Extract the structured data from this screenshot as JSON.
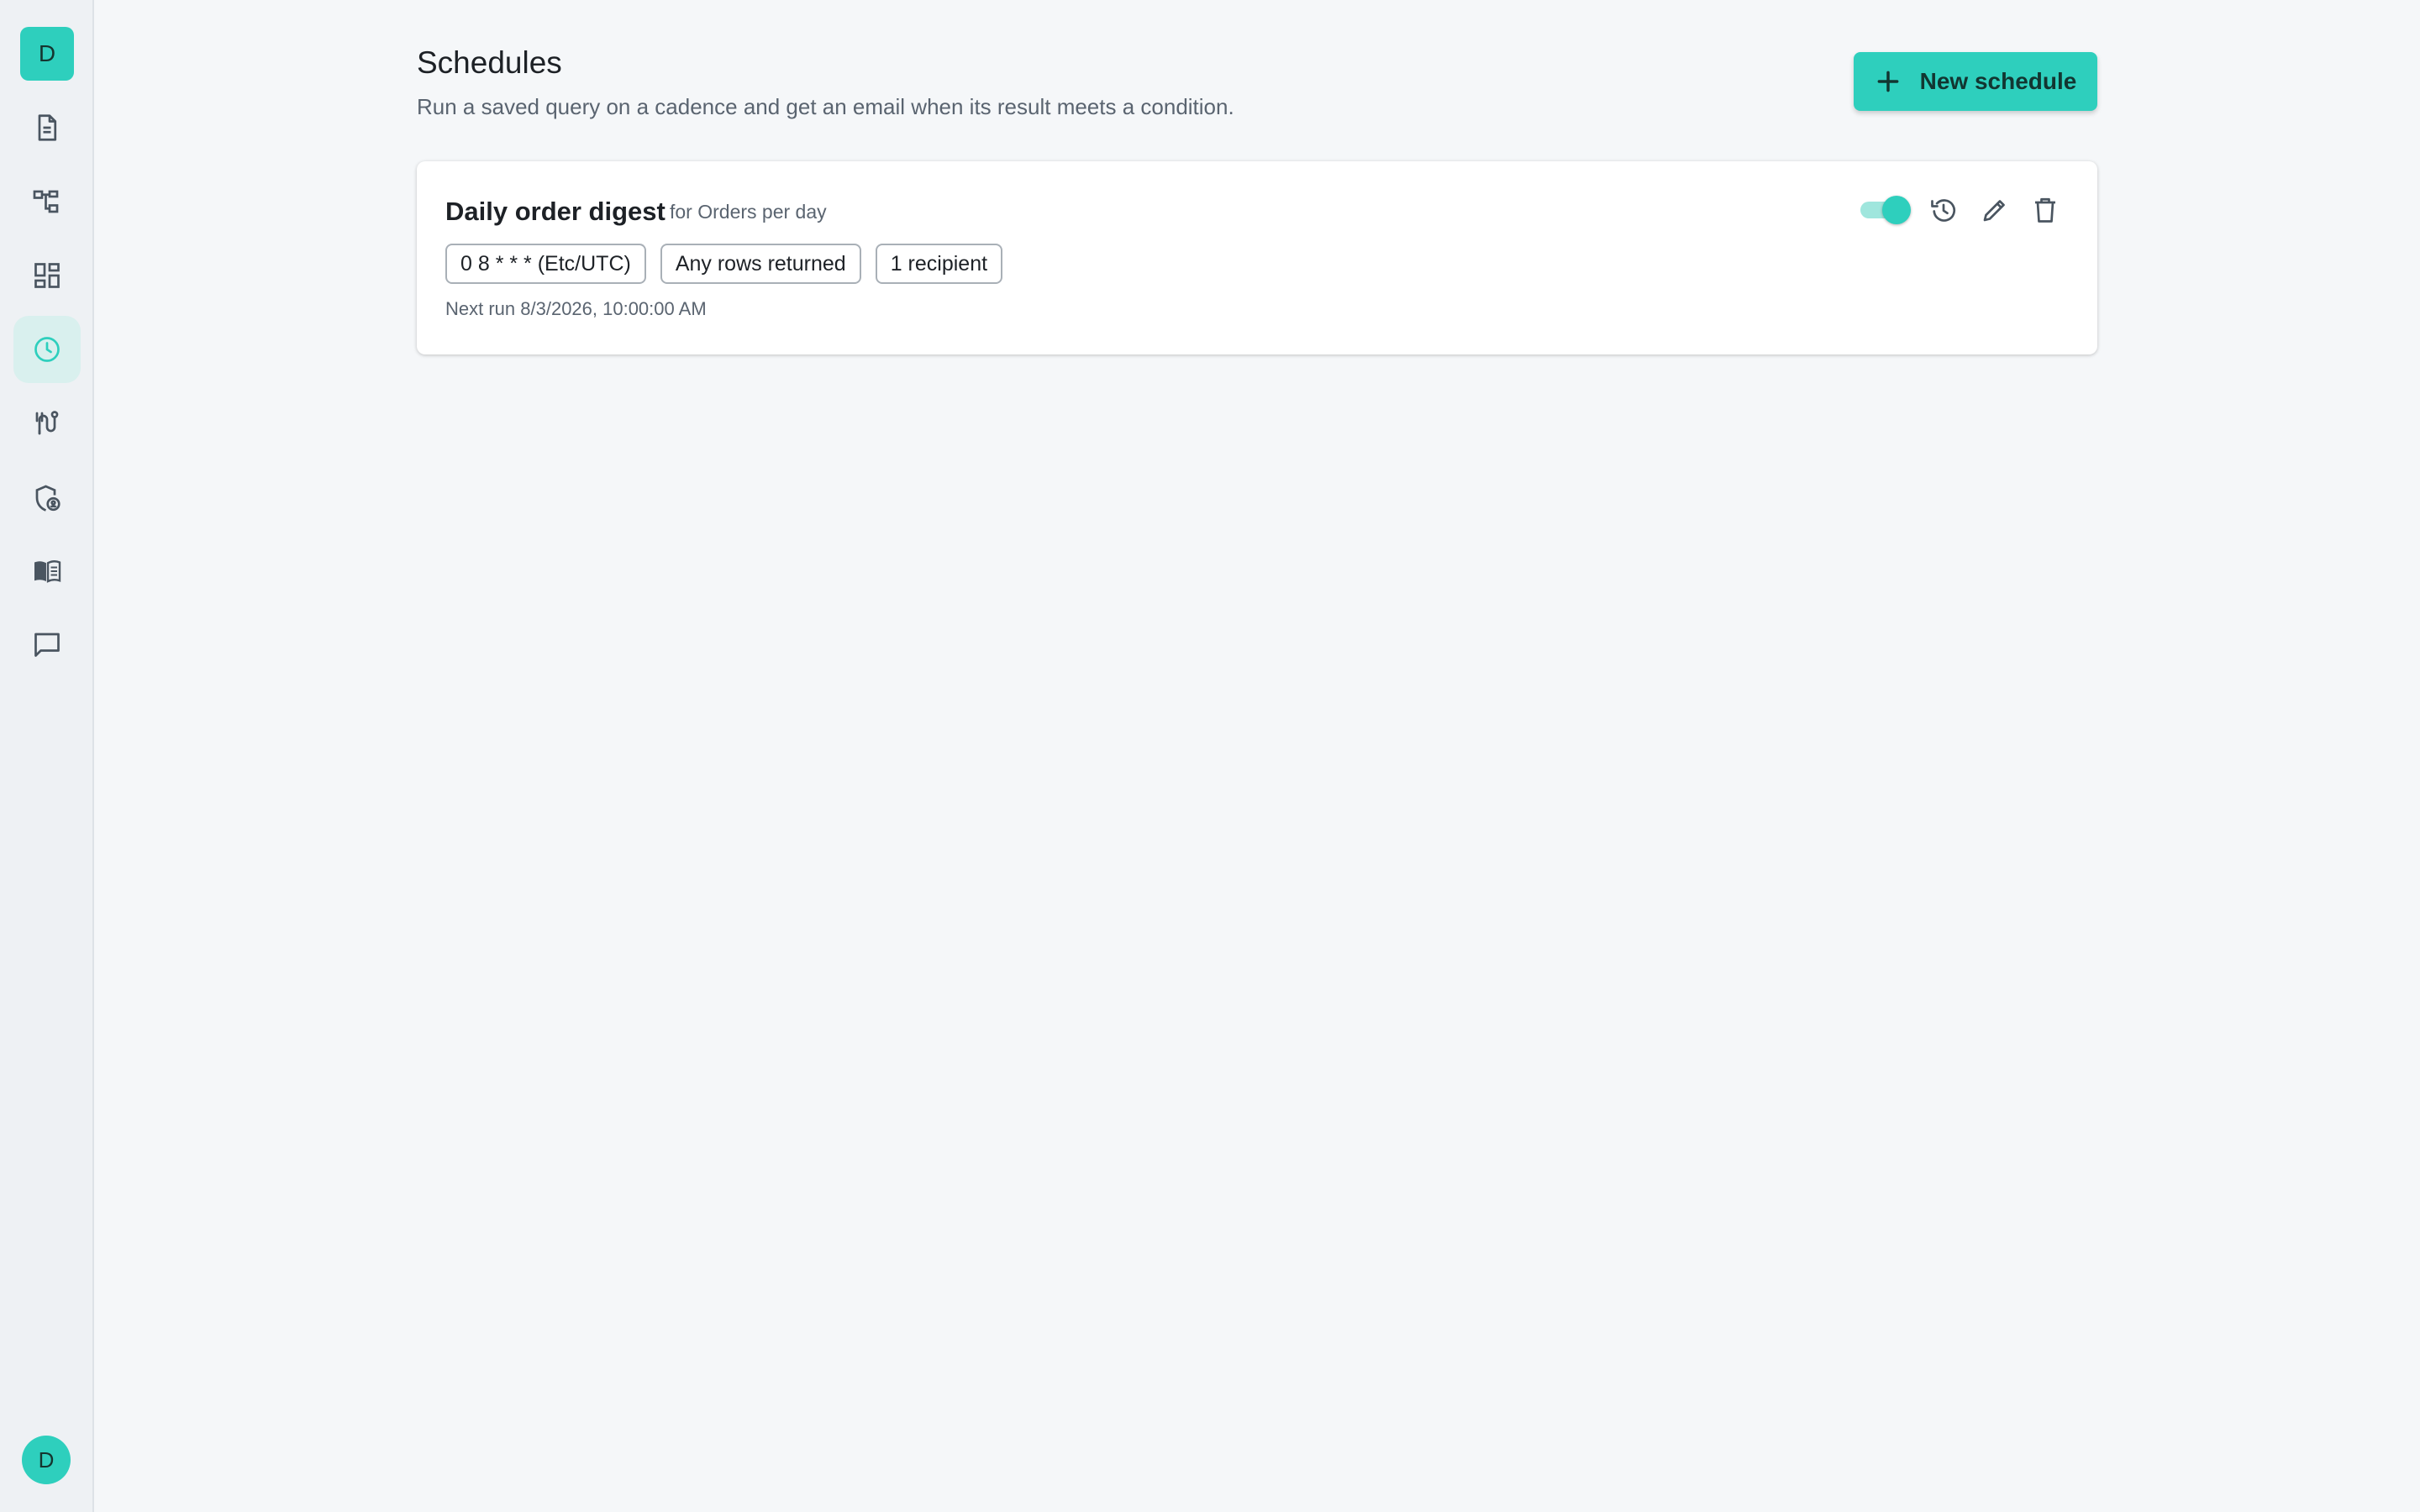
{
  "sidebar": {
    "workspace_initial": "D",
    "items": [
      {
        "icon": "document-icon"
      },
      {
        "icon": "schema-icon"
      },
      {
        "icon": "dashboard-icon"
      },
      {
        "icon": "clock-icon",
        "active": true
      },
      {
        "icon": "route-icon"
      },
      {
        "icon": "shield-user-icon"
      },
      {
        "icon": "book-icon"
      },
      {
        "icon": "chat-icon"
      }
    ],
    "user_initial": "D"
  },
  "header": {
    "title": "Schedules",
    "subtitle": "Run a saved query on a cadence and get an email when its result meets a condition.",
    "new_button_label": "New schedule"
  },
  "schedules": [
    {
      "name": "Daily order digest",
      "query_ref": "for Orders per day",
      "cron": "0 8 * * * (Etc/UTC)",
      "condition": "Any rows returned",
      "recipients": "1 recipient",
      "next_run": "Next run 8/3/2026, 10:00:00 AM",
      "enabled": true
    }
  ],
  "colors": {
    "accent": "#2ecfbd",
    "accent_light": "#d9f0ee",
    "icon": "#4a5560"
  }
}
